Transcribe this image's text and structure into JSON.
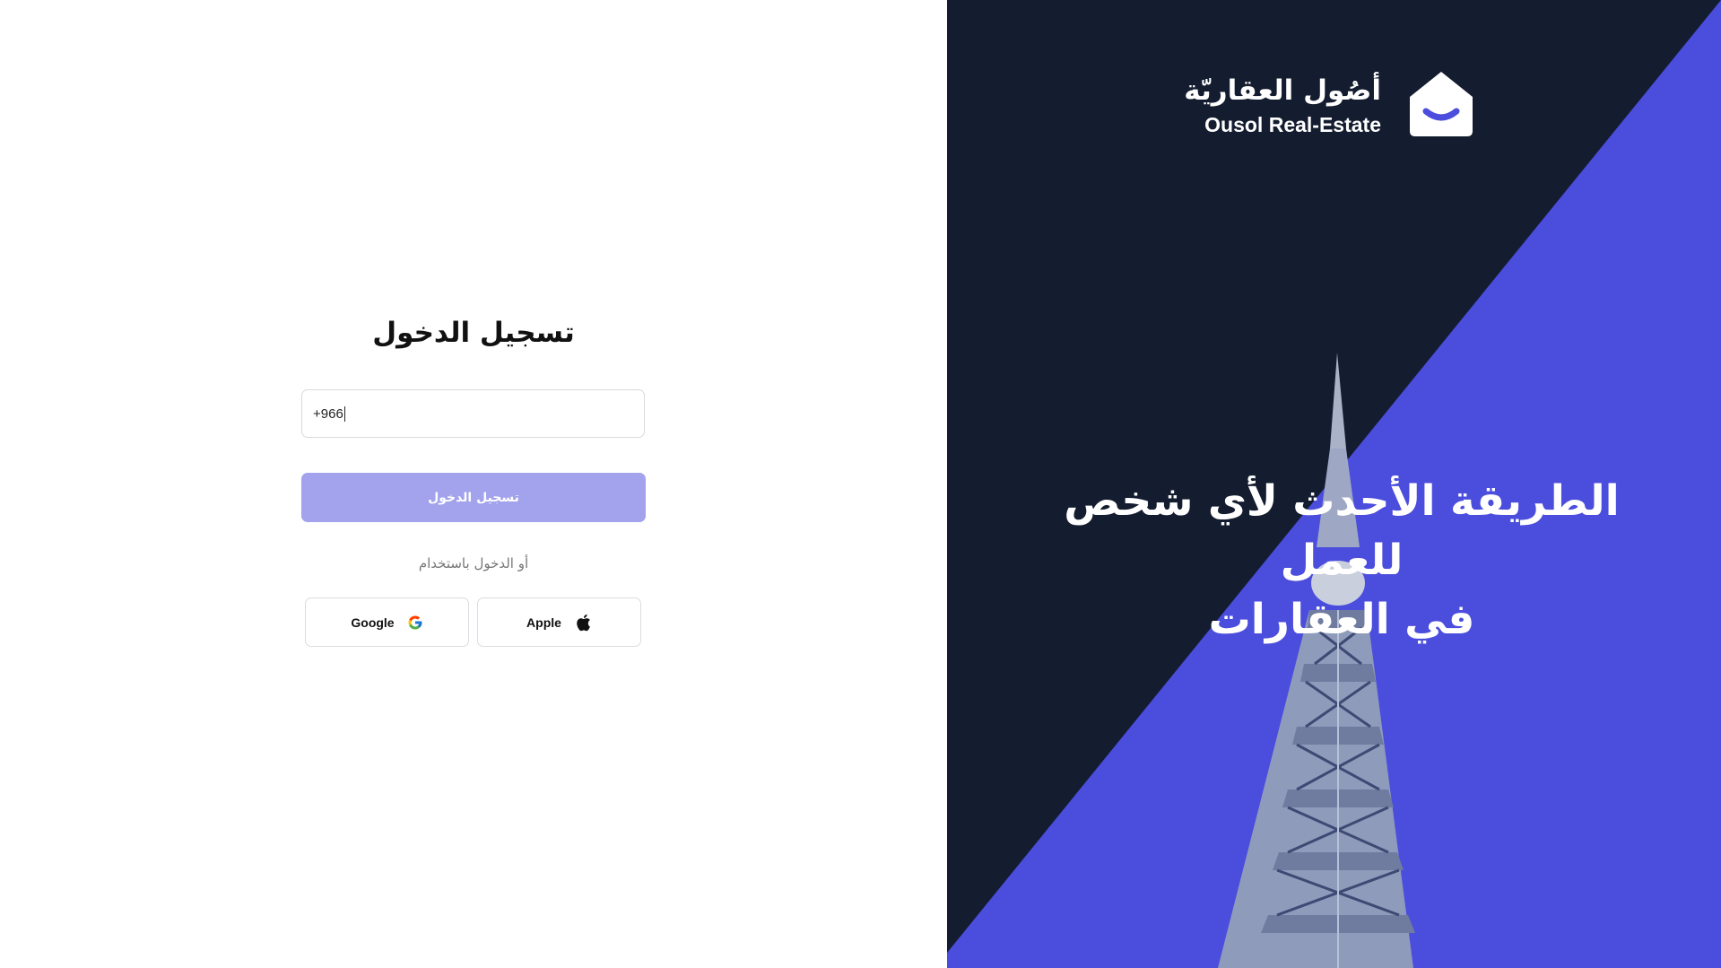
{
  "login": {
    "title": "تسجيل الدخول",
    "phone_value": "+966",
    "submit_label": "تسجيل الدخول",
    "or_text": "أو الدخول باستخدام",
    "social": {
      "google_label": "Google",
      "apple_label": "Apple"
    }
  },
  "brand": {
    "name_ar": "أصُول العقاريّة",
    "name_en": "Ousol Real-Estate",
    "logo_icon": "house-smile-icon"
  },
  "hero": {
    "tagline_line1": "الطريقة الأحدث لأي شخص للعمل",
    "tagline_line2": "في العقارات"
  },
  "colors": {
    "accent": "#4b4ddd",
    "button_disabled": "#a3a2ec",
    "dark_panel": "#141c30"
  }
}
